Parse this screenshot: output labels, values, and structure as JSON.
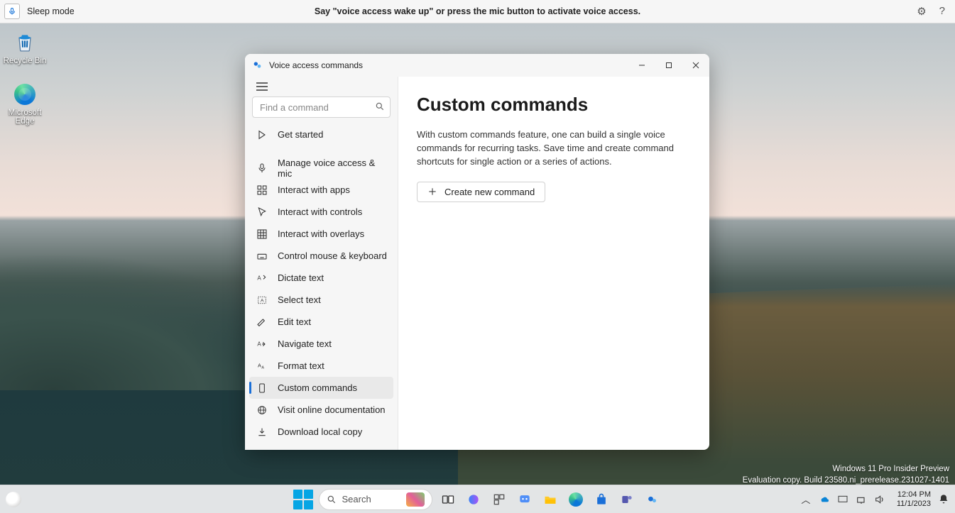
{
  "voice_bar": {
    "status": "Sleep mode",
    "hint": "Say \"voice access wake up\" or press the mic button to activate voice access."
  },
  "desktop": {
    "recycle_label": "Recycle Bin",
    "edge_label": "Microsoft Edge"
  },
  "window": {
    "title": "Voice access commands",
    "search_placeholder": "Find a command",
    "nav": {
      "get_started": "Get started",
      "manage_mic": "Manage voice access & mic",
      "interact_apps": "Interact with apps",
      "interact_controls": "Interact with controls",
      "interact_overlays": "Interact with overlays",
      "mouse_keyboard": "Control mouse & keyboard",
      "dictate": "Dictate text",
      "select": "Select text",
      "edit": "Edit text",
      "navigate": "Navigate text",
      "format": "Format text",
      "custom": "Custom commands",
      "visit_docs": "Visit online documentation",
      "download": "Download local copy"
    },
    "content": {
      "heading": "Custom commands",
      "desc": "With custom commands feature, one can build a single voice commands for recurring tasks. Save time and create command shortcuts for single action or a series of actions.",
      "create_btn": "Create new command"
    }
  },
  "watermark": {
    "line1": "Windows 11 Pro Insider Preview",
    "line2": "Evaluation copy. Build 23580.ni_prerelease.231027-1401"
  },
  "taskbar": {
    "search_label": "Search",
    "time": "12:04 PM",
    "date": "11/1/2023"
  }
}
